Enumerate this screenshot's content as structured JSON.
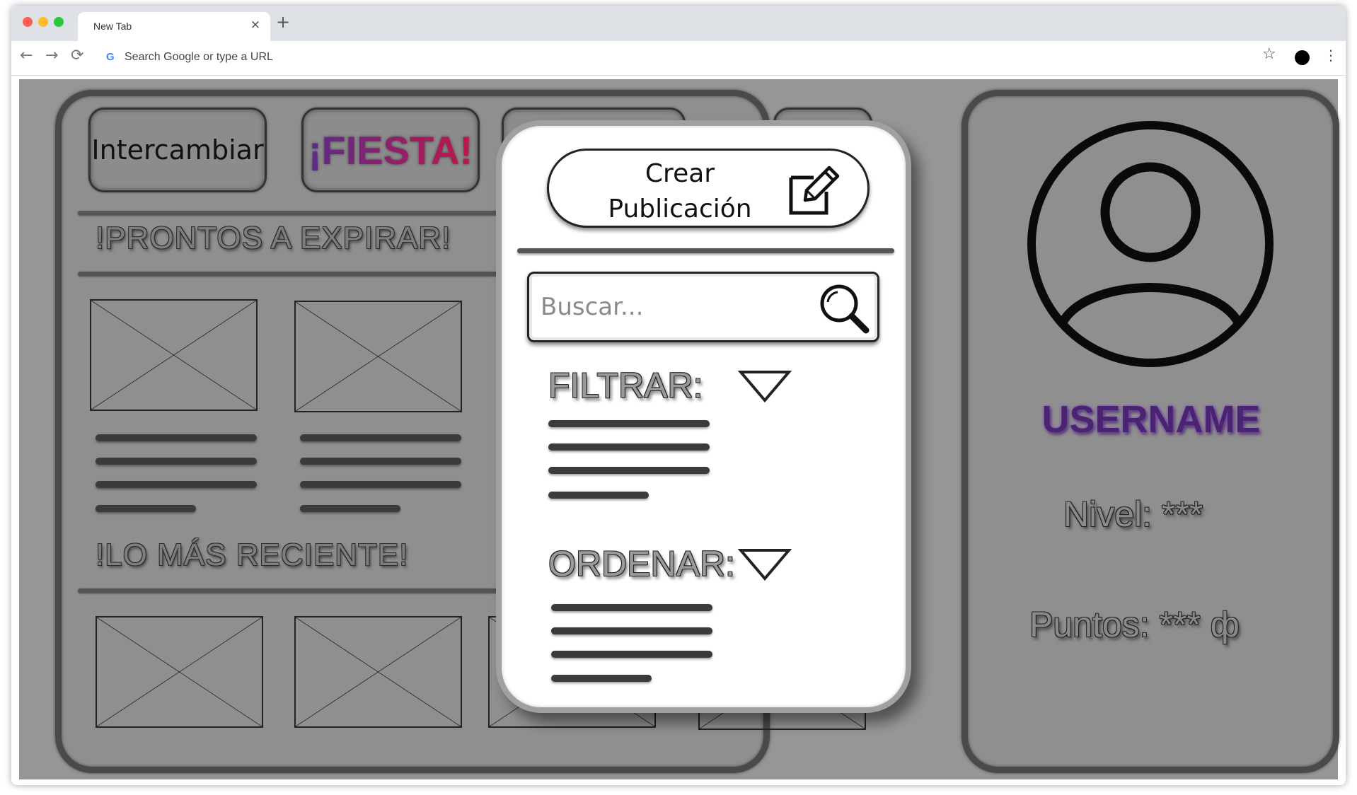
{
  "browser": {
    "tab_title": "New Tab",
    "tab_close": "×",
    "new_tab": "+",
    "omnibox_placeholder": "Search Google or type a URL",
    "omnibox_logo": "G",
    "nav": {
      "back": "←",
      "forward": "→",
      "reload": "⟳"
    },
    "star": "☆",
    "menu": "⋮"
  },
  "top_buttons": {
    "intercambiar": "Intercambiar",
    "fiesta": "¡FIESTA!"
  },
  "sections": {
    "expiring": "!PRONTOS A EXPIRAR!",
    "recent": "!LO MÁS RECIENTE!"
  },
  "popup": {
    "create_post": "Crear\nPublicación",
    "search_placeholder": "Buscar...",
    "filter_label": "FILTRAR:",
    "sort_label": "ORDENAR:"
  },
  "profile": {
    "username": "USERNAME",
    "level": "Nivel: ***",
    "points": "Puntos: *** ф"
  },
  "icons": {
    "edit": "edit-icon",
    "search": "search-icon",
    "avatar": "user-avatar-icon",
    "chevron": "chevron-down-icon"
  },
  "colors": {
    "page_bg": "#969696",
    "panel_border": "#4a4a4a",
    "username": "#4a2470",
    "fiesta_start": "#5b2b8a",
    "fiesta_end": "#c0164a"
  }
}
